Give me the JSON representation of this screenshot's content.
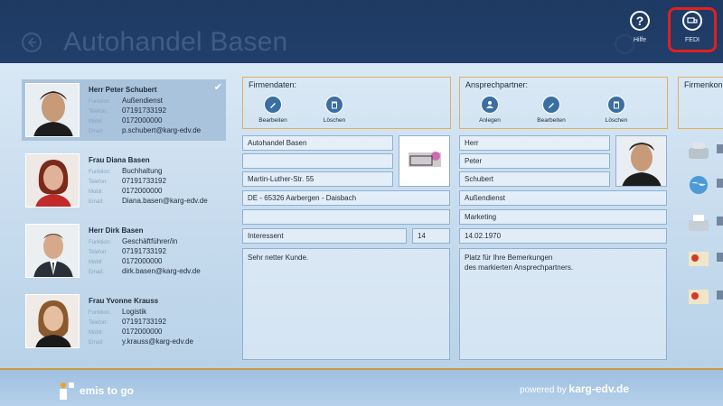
{
  "header": {
    "title": "Autohandel Basen",
    "buttons": [
      {
        "label": "Hilfe",
        "icon": "help-icon"
      },
      {
        "label": "FEDI",
        "icon": "fedi-icon"
      }
    ]
  },
  "contacts": [
    {
      "name": "Herr Peter Schubert",
      "funktion": "Außendienst",
      "telefon": "07191733192",
      "mobil": "0172000000",
      "email": "p.schubert@karg-edv.de",
      "selected": true
    },
    {
      "name": "Frau Diana Basen",
      "funktion": "Buchhaltung",
      "telefon": "07191733192",
      "mobil": "0172000000",
      "email": "Diana.basen@karg-edv.de",
      "selected": false
    },
    {
      "name": "Herr Dirk Basen",
      "funktion": "Geschäftführer/in",
      "telefon": "07191733192",
      "mobil": "0172000000",
      "email": "dirk.basen@karg-edv.de",
      "selected": false
    },
    {
      "name": "Frau Yvonne Krauss",
      "funktion": "Logistik",
      "telefon": "07191733192",
      "mobil": "0172000000",
      "email": "y.krauss@karg-edv.de",
      "selected": false
    }
  ],
  "labels": {
    "funktion": "Funktion:",
    "telefon": "Telefon:",
    "mobil": "Mobil:",
    "email": "Email:"
  },
  "firmendaten": {
    "title": "Firmendaten:",
    "tools": [
      "Bearbeiten",
      "Löschen"
    ],
    "fields": {
      "name": "Autohandel Basen",
      "name2": "",
      "street": "Martin-Luther-Str. 55",
      "city": "DE - 65326 Aarbergen - Daisbach",
      "extra": "",
      "status": "Interessent",
      "number": "14",
      "notes": "Sehr netter Kunde."
    }
  },
  "ansprechpartner": {
    "title": "Ansprechpartner:",
    "tools": [
      "Anlegen",
      "Bearbeiten",
      "Löschen"
    ],
    "fields": {
      "anrede": "Herr",
      "vorname": "Peter",
      "nachname": "Schubert",
      "funktion": "Außendienst",
      "abteilung": "Marketing",
      "geburtsdatum": "14.02.1970",
      "notes_line1": "Platz für Ihre Bemerkungen",
      "notes_line2": "des markierten Ansprechpartners."
    }
  },
  "firmenkontakt": {
    "title": "Firmenkon"
  },
  "footer": {
    "brand": "emis to go",
    "powered_prefix": "powered by",
    "powered_brand": "karg-edv.de"
  },
  "colors": {
    "header": "#1d3a63",
    "accent": "#e0b05a",
    "highlight": "#e02020"
  }
}
